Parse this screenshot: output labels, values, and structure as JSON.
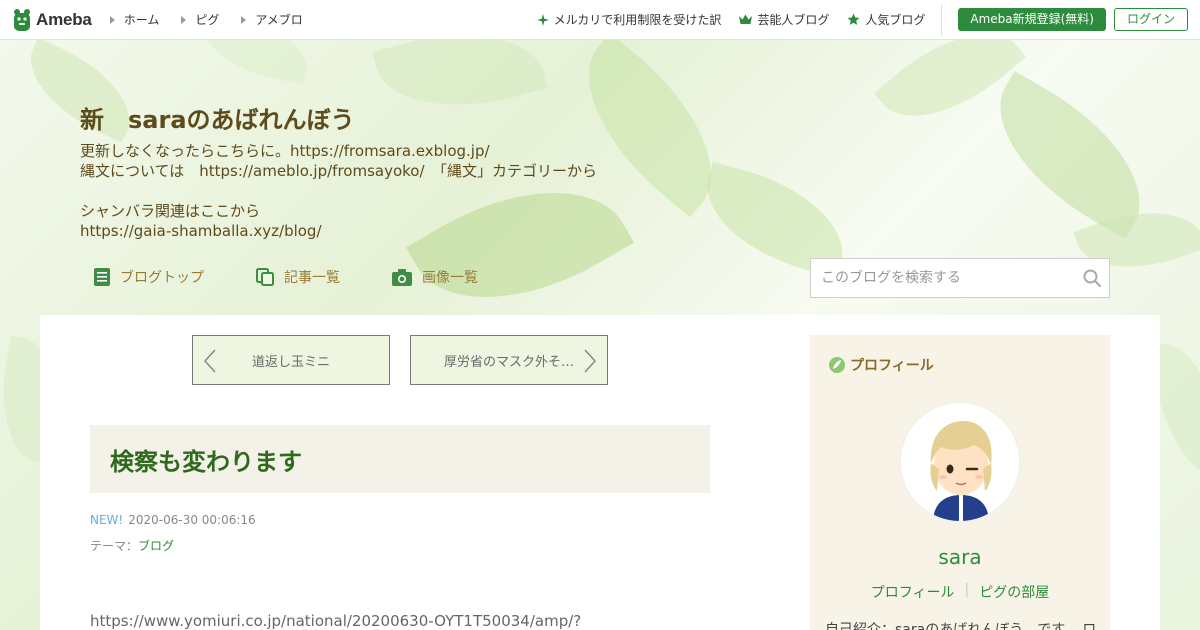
{
  "topbar": {
    "logo": "Ameba",
    "nav": [
      "ホーム",
      "ピグ",
      "アメブロ"
    ],
    "links": [
      {
        "icon": "sparkle-icon",
        "label": "メルカリで利用制限を受けた訳"
      },
      {
        "icon": "crown-icon",
        "label": "芸能人ブログ"
      },
      {
        "icon": "star-icon",
        "label": "人気ブログ"
      }
    ],
    "register": "Ameba新規登録(無料)",
    "login": "ログイン"
  },
  "header": {
    "title": "新　saraのあばれんぼう",
    "desc": [
      "更新しなくなったらこちらに。https://fromsara.exblog.jp/",
      "縄文については　https://ameblo.jp/fromsayoko/　「縄文」カテゴリーから",
      "シャンバラ関連はここから",
      "https://gaia-shamballa.xyz/blog/"
    ],
    "tabs": [
      "ブログトップ",
      "記事一覧",
      "画像一覧"
    ],
    "search_placeholder": "このブログを検索する"
  },
  "entry": {
    "prev": "道返し玉ミニ",
    "next": "厚労省のマスク外そ…",
    "title": "検察も変わります",
    "new_badge": "NEW!",
    "datetime": "2020-06-30 00:06:16",
    "theme_label": "テーマ：",
    "theme": "ブログ",
    "url": "https://www.yomiuri.co.jp/national/20200630-OYT1T50034/amp/?"
  },
  "sidebar": {
    "title": "プロフィール",
    "name": "sara",
    "links": [
      "プロフィール",
      "ピグの部屋"
    ],
    "intro": "自己紹介：saraのあばれんぼう　です。 ロ"
  },
  "colors": {
    "brand_green": "#2d8c3c",
    "title_brown": "#5e4b1c",
    "tab_gold": "#9a7b36"
  }
}
